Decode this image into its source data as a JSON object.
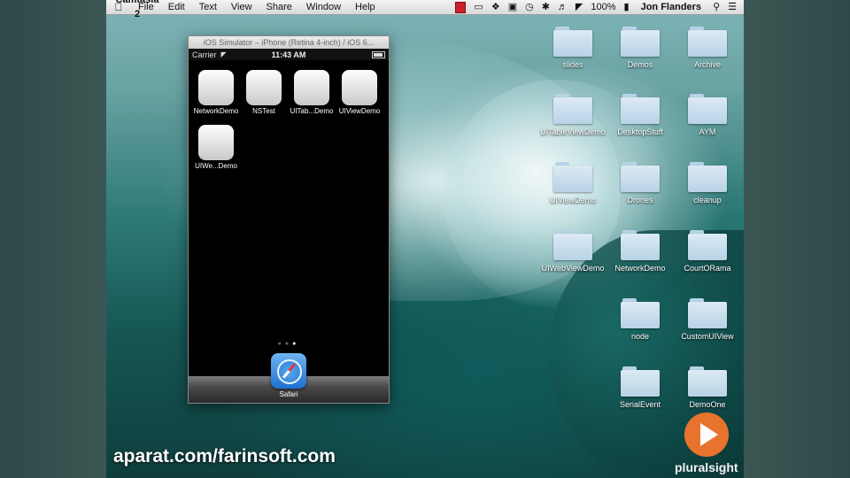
{
  "menubar": {
    "app_name": "Camtasia 2",
    "items": [
      "File",
      "Edit",
      "Text",
      "View",
      "Share",
      "Window",
      "Help"
    ],
    "battery_percent": "100%",
    "user_name": "Jon Flanders"
  },
  "simulator": {
    "window_title": "iOS Simulator – iPhone (Retina 4-inch) / iOS 6...",
    "carrier": "Carrier",
    "time": "11:43 AM",
    "apps": [
      {
        "label": "NetworkDemo"
      },
      {
        "label": "NSTest"
      },
      {
        "label": "UITab...Demo"
      },
      {
        "label": "UIViewDemo"
      },
      {
        "label": "UIWe...Demo"
      }
    ],
    "dock_app": "Safari"
  },
  "desktop": {
    "folders": [
      {
        "label": "slides"
      },
      {
        "label": "Demos"
      },
      {
        "label": "Archive"
      },
      {
        "label": "UITableViewDemo"
      },
      {
        "label": "DesktopStuff"
      },
      {
        "label": "AYM"
      },
      {
        "label": "UIViewDemo"
      },
      {
        "label": "Drones"
      },
      {
        "label": "cleanup"
      },
      {
        "label": "UIWebViewDemo"
      },
      {
        "label": "NetworkDemo"
      },
      {
        "label": "CourtORama"
      },
      {
        "label": "node"
      },
      {
        "label": "CustomUIView"
      },
      {
        "label": "SerialEvent"
      },
      {
        "label": "DemoOne"
      }
    ]
  },
  "watermarks": {
    "aparat": "aparat.com/farinsoft.com",
    "pluralsight": "pluralsight"
  }
}
